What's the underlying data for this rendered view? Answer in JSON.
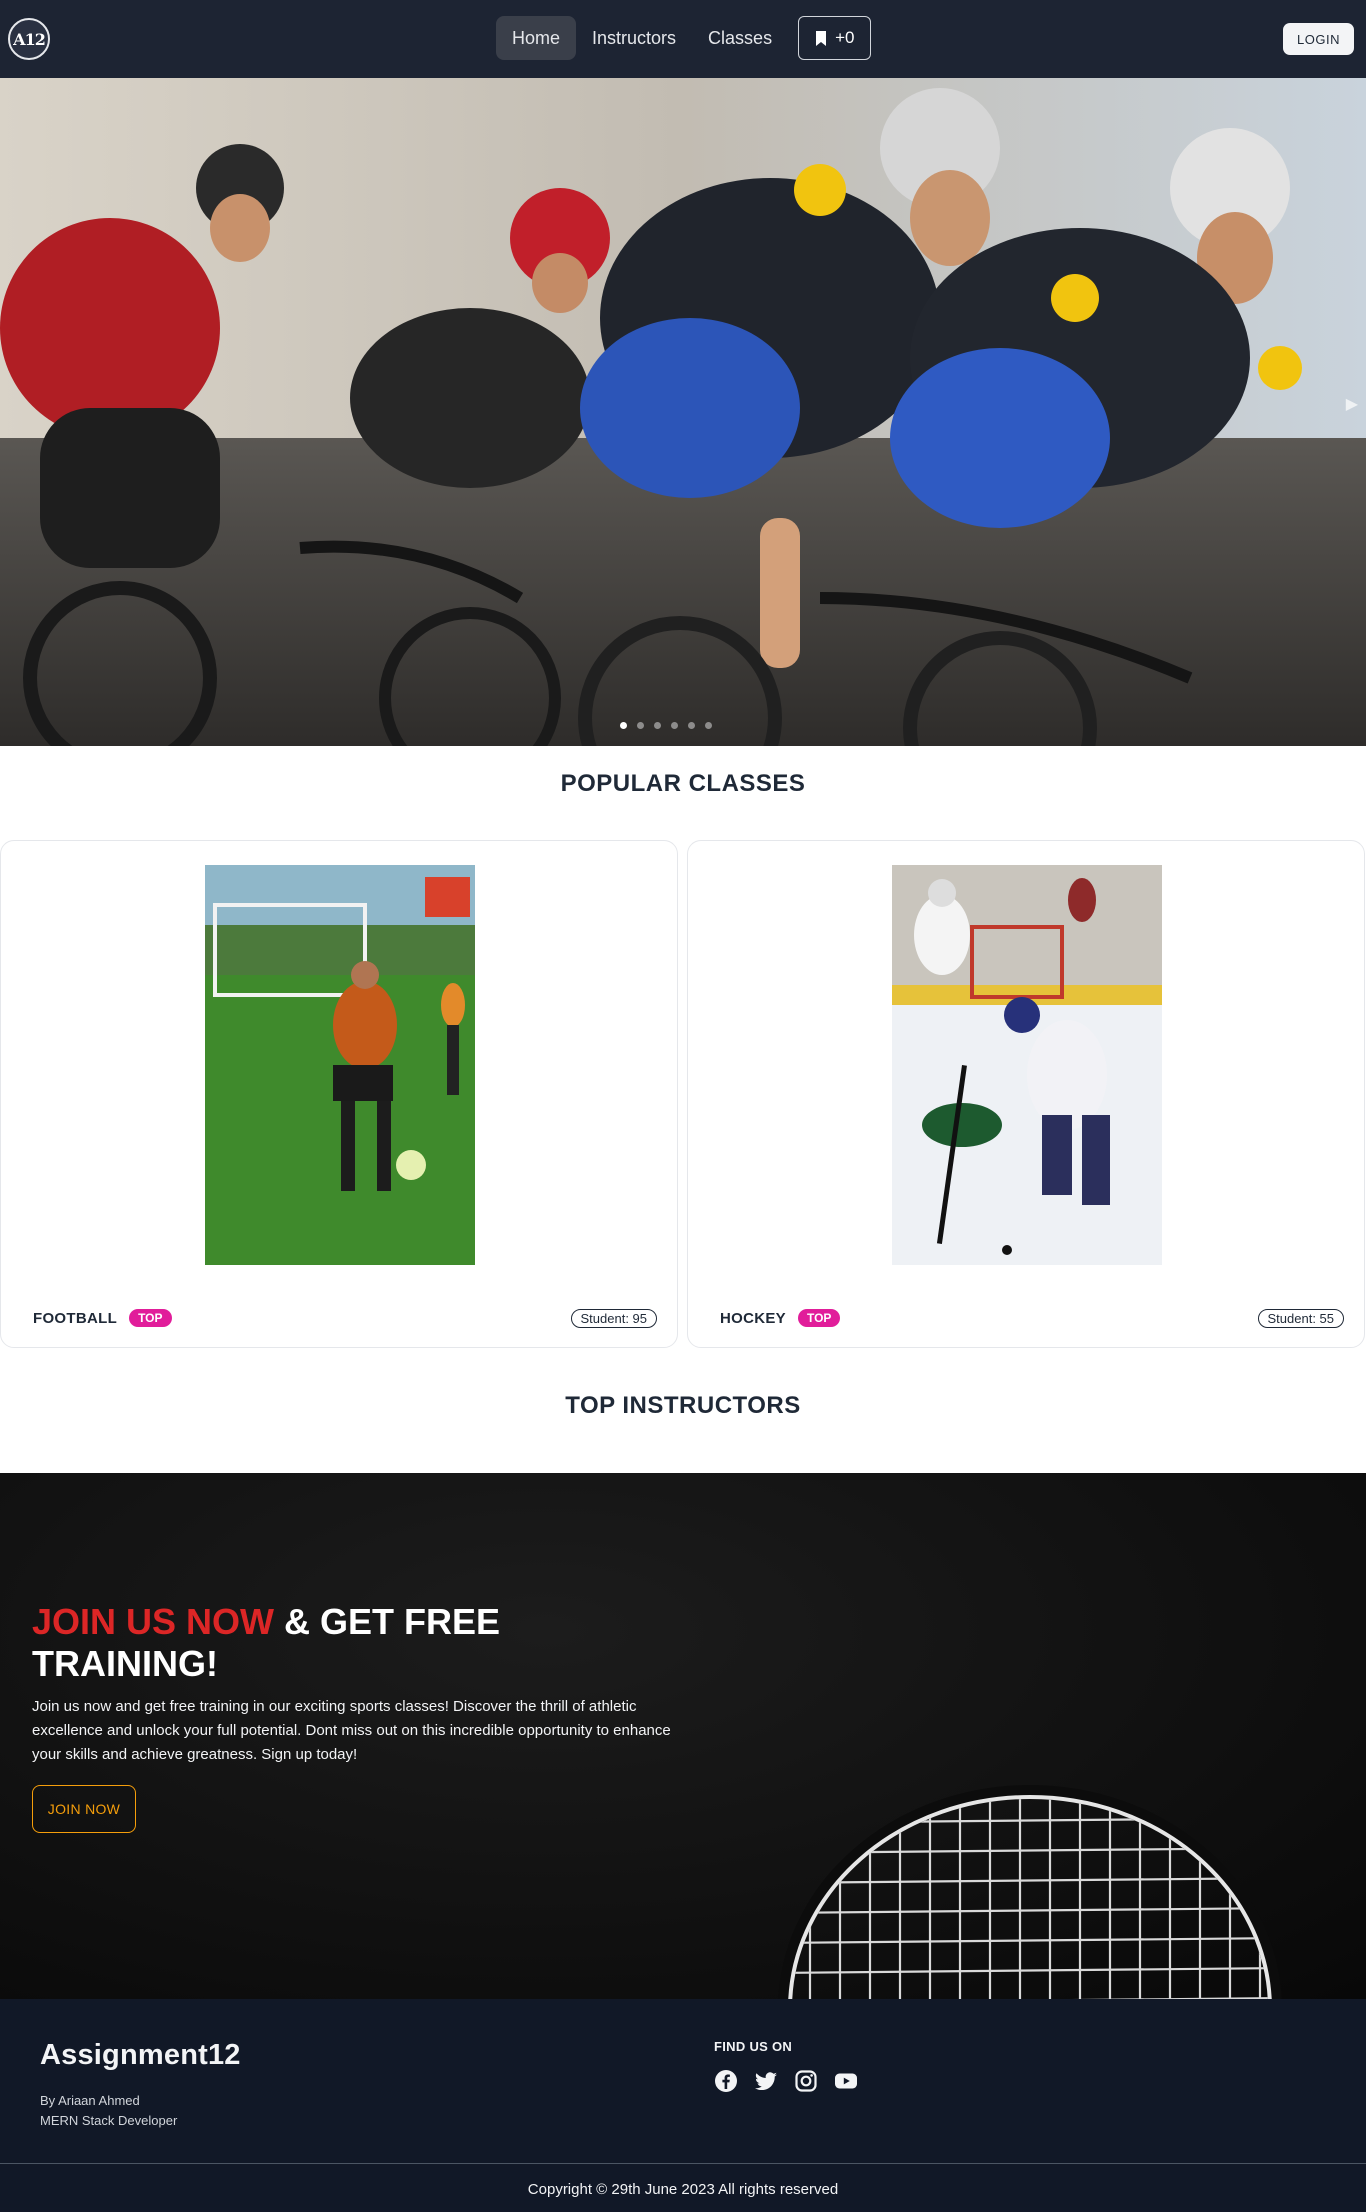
{
  "navbar": {
    "logo_text": "A12",
    "links": [
      {
        "label": "Home",
        "active": true
      },
      {
        "label": "Instructors",
        "active": false
      },
      {
        "label": "Classes",
        "active": false
      }
    ],
    "bookmark_count": "+0",
    "bookmark_icon": "bookmark-icon",
    "login_label": "LOGIN"
  },
  "hero": {
    "slide_count": 6,
    "active_slide": 1,
    "next_icon": "chevron-right-icon"
  },
  "popular_classes": {
    "title": "POPULAR CLASSES",
    "items": [
      {
        "name": "FOOTBALL",
        "badge": "TOP",
        "students": "Student: 95"
      },
      {
        "name": "HOCKEY",
        "badge": "TOP",
        "students": "Student: 55"
      }
    ]
  },
  "top_instructors": {
    "title": "TOP INSTRUCTORS"
  },
  "join": {
    "title_highlight": "JOIN US NOW",
    "title_rest": " & GET FREE TRAINING!",
    "text": "Join us now and get free training in our exciting sports classes! Discover the thrill of athletic excellence and unlock your full potential. Dont miss out on this incredible opportunity to enhance your skills and achieve greatness. Sign up today!",
    "button_label": "JOIN NOW",
    "colors": {
      "highlight": "#dc2626",
      "button": "#f59e0b"
    }
  },
  "footer": {
    "brand": "Assignment12",
    "author": "By Ariaan Ahmed",
    "role": "MERN Stack Developer",
    "find_us_title": "FIND US ON",
    "socials": [
      "facebook-icon",
      "twitter-icon",
      "instagram-icon",
      "youtube-icon"
    ],
    "copyright": "Copyright © 29th June 2023 All rights reserved"
  },
  "colors": {
    "navbar_bg": "#1d2433",
    "footer_bg": "#111827",
    "badge": "#e11d9a"
  }
}
